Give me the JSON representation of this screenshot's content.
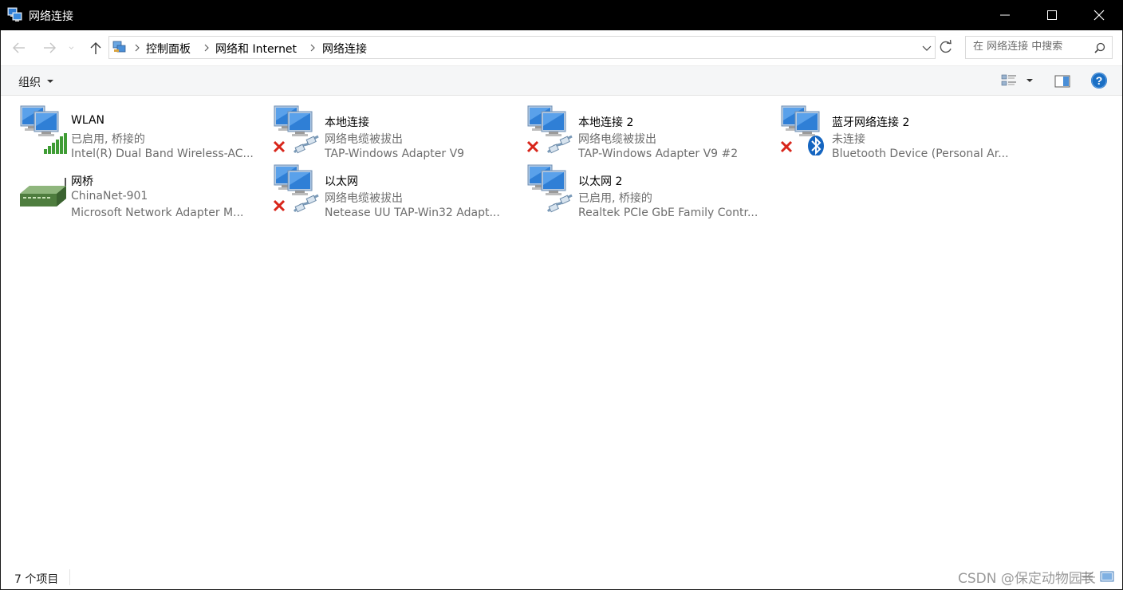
{
  "window": {
    "title": "网络连接",
    "controls": {
      "minimize": "minimize-icon",
      "maximize": "maximize-icon",
      "close": "close-icon"
    }
  },
  "nav": {
    "breadcrumb": [
      "控制面板",
      "网络和 Internet",
      "网络连接"
    ],
    "search_placeholder": "在 网络连接 中搜索"
  },
  "toolbar": {
    "organize_label": "组织"
  },
  "connections": [
    {
      "name": "WLAN",
      "status": "已启用, 桥接的",
      "device": "Intel(R) Dual Band Wireless-AC...",
      "type": "wireless",
      "badge": "signal-bars",
      "disabled": false
    },
    {
      "name": "本地连接",
      "status": "网络电缆被拔出",
      "device": "TAP-Windows Adapter V9",
      "type": "ethernet",
      "badge": "cable",
      "disabled": true
    },
    {
      "name": "本地连接 2",
      "status": "网络电缆被拔出",
      "device": "TAP-Windows Adapter V9 #2",
      "type": "ethernet",
      "badge": "cable",
      "disabled": true
    },
    {
      "name": "蓝牙网络连接 2",
      "status": "未连接",
      "device": "Bluetooth Device (Personal Ar...",
      "type": "bluetooth",
      "badge": "bluetooth",
      "disabled": true
    },
    {
      "name": "网桥",
      "status": "ChinaNet-901",
      "device": "Microsoft Network Adapter M...",
      "type": "bridge",
      "badge": "none",
      "disabled": false
    },
    {
      "name": "以太网",
      "status": "网络电缆被拔出",
      "device": "Netease UU TAP-Win32 Adapt...",
      "type": "ethernet",
      "badge": "cable",
      "disabled": true
    },
    {
      "name": "以太网 2",
      "status": "已启用, 桥接的",
      "device": "Realtek PCIe GbE Family Contr...",
      "type": "ethernet",
      "badge": "cable",
      "disabled": false
    }
  ],
  "statusbar": {
    "item_count": "7 个项目",
    "watermark": "CSDN @保定动物园长"
  },
  "colors": {
    "titlebar_bg": "#000000",
    "accent": "#0078d7",
    "help_blue": "#1b6fc4",
    "error_red": "#d8261b",
    "signal_green": "#3f9c35",
    "secondary_text": "#6d6d6d"
  }
}
